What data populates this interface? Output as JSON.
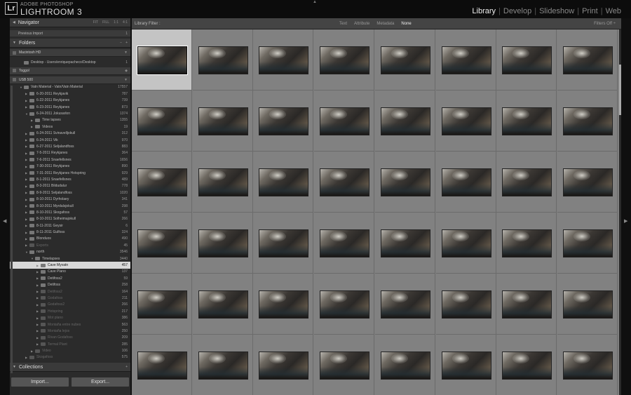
{
  "header": {
    "brand_top": "ADOBE PHOTOSHOP",
    "brand": "LIGHTROOM 3",
    "logo": "Lr",
    "modules": [
      "Library",
      "Develop",
      "Slideshow",
      "Print",
      "Web"
    ],
    "active_module": "Library"
  },
  "left": {
    "navigator_title": "Navigator",
    "navigator_opts": [
      "FIT",
      "FILL",
      "1:1",
      "4:1"
    ],
    "previous_import": {
      "label": "Previous Import",
      "count": "1"
    },
    "folders_title": "Folders",
    "volumes": [
      {
        "name": "Macintosh HD",
        "right": "▼"
      },
      {
        "name": "Toggol",
        "right": "◆"
      },
      {
        "name": "USB 500",
        "right": "▼"
      }
    ],
    "desktop": {
      "label": "Desktop - Users/enriquepacheco/Desktop",
      "count": "1"
    },
    "folder_rows": [
      {
        "name": "Vatn Material - Vatn/Vatn Material",
        "count": "17557",
        "indent": 1,
        "open": true
      },
      {
        "name": "6-20-2011 Reykjavik",
        "count": "787",
        "indent": 2
      },
      {
        "name": "6-22-2011 Reykjanes",
        "count": "739",
        "indent": 2
      },
      {
        "name": "6-23-2011 Reykjanes",
        "count": "873",
        "indent": 2
      },
      {
        "name": "6-24-2011 Jokusarlon",
        "count": "1374",
        "indent": 2,
        "open": true
      },
      {
        "name": "Time lapses",
        "count": "1355",
        "indent": 3
      },
      {
        "name": "Videos",
        "count": "19",
        "indent": 3
      },
      {
        "name": "6-24-2011 Svinavelljokull",
        "count": "312",
        "indent": 2
      },
      {
        "name": "6-24-2011 Vik",
        "count": "970",
        "indent": 2
      },
      {
        "name": "6-27-2011 Seljalandfoss",
        "count": "883",
        "indent": 2
      },
      {
        "name": "7-5-2011 Reykjanes",
        "count": "364",
        "indent": 2
      },
      {
        "name": "7-6-2011 Snaefellsnes",
        "count": "1656",
        "indent": 2
      },
      {
        "name": "7-30-2011 Reykjanes",
        "count": "890",
        "indent": 2
      },
      {
        "name": "7-31-2011 Reykjanes Hotspring",
        "count": "929",
        "indent": 2
      },
      {
        "name": "8-1-2011 Snaefellsnes",
        "count": "489",
        "indent": 2
      },
      {
        "name": "8-3-2011 Bildudalur",
        "count": "778",
        "indent": 2
      },
      {
        "name": "8-9-2011 Seljalandfoss",
        "count": "1020",
        "indent": 2
      },
      {
        "name": "8-10-2011 Dyrholaey",
        "count": "341",
        "indent": 2
      },
      {
        "name": "8-10-2011 Myrdalsjokull",
        "count": "298",
        "indent": 2
      },
      {
        "name": "8-10-2011 Skogafoss",
        "count": "57",
        "indent": 2
      },
      {
        "name": "8-10-2011 Solheimajokull",
        "count": "266",
        "indent": 2
      },
      {
        "name": "8-11-2011 Geysir",
        "count": "6",
        "indent": 2
      },
      {
        "name": "8-11-2011 Gulfoss",
        "count": "324",
        "indent": 2
      },
      {
        "name": "Blonduos",
        "count": "490",
        "indent": 2
      },
      {
        "name": "Exports",
        "count": "45",
        "indent": 2,
        "dim": true
      },
      {
        "name": "north",
        "count": "3546",
        "indent": 2,
        "open": true
      },
      {
        "name": "Timelapses",
        "count": "3440",
        "indent": 3,
        "open": true
      },
      {
        "name": "Cave Myvatn",
        "count": "457",
        "indent": 4,
        "selected": true
      },
      {
        "name": "Cave Plano",
        "count": "137",
        "indent": 4
      },
      {
        "name": "Detifoss2",
        "count": "59",
        "indent": 4
      },
      {
        "name": "Detifoss",
        "count": "258",
        "indent": 4
      },
      {
        "name": "Detifoss2",
        "count": "164",
        "indent": 4,
        "dim": true
      },
      {
        "name": "Godafoss",
        "count": "211",
        "indent": 4,
        "dim": true
      },
      {
        "name": "Godafoss2",
        "count": "266",
        "indent": 4,
        "dim": true
      },
      {
        "name": "Hotspring",
        "count": "217",
        "indent": 4,
        "dim": true
      },
      {
        "name": "Mot plano",
        "count": "386",
        "indent": 4,
        "dim": true
      },
      {
        "name": "Montaña entre nubes",
        "count": "563",
        "indent": 4,
        "dim": true
      },
      {
        "name": "Montaña lejos",
        "count": "250",
        "indent": 4,
        "dim": true
      },
      {
        "name": "Rivan Godafoss",
        "count": "209",
        "indent": 4,
        "dim": true
      },
      {
        "name": "Termal Plant",
        "count": "285",
        "indent": 4,
        "dim": true
      },
      {
        "name": "Video",
        "count": "106",
        "indent": 3,
        "dim": true
      },
      {
        "name": "Skogafoss",
        "count": "575",
        "indent": 2,
        "dim": true
      }
    ],
    "collections_title": "Collections",
    "import_label": "Import...",
    "export_label": "Export..."
  },
  "filter": {
    "label": "Library Filter :",
    "options": [
      "Text",
      "Attribute",
      "Metadata",
      "None"
    ],
    "active": "None",
    "status": "Filters Off ÷"
  },
  "grid": {
    "rows": 6,
    "cols": 8,
    "selected_index": 0
  }
}
